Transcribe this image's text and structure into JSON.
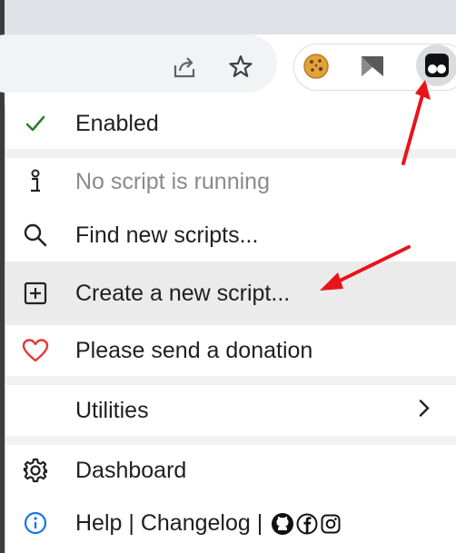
{
  "browser": {
    "toolbar_icons": {
      "share": "share-icon",
      "bookmark": "star-icon",
      "cookie_ext": "cookie-icon",
      "bookmark_ext": "bookmark-flag-icon",
      "tampermonkey": "tampermonkey-icon"
    }
  },
  "menu": {
    "enabled_label": "Enabled",
    "no_script_label": "No script is running",
    "find_label": "Find new scripts...",
    "create_label": "Create a new script...",
    "donate_label": "Please send a donation",
    "utilities_label": "Utilities",
    "dashboard_label": "Dashboard",
    "help_label": "Help",
    "divider": "|",
    "changelog_label": "Changelog"
  },
  "colors": {
    "check": "#2e7d32",
    "heart": "#e53935",
    "info": "#1a73e8",
    "annotation_arrow": "#e8141c"
  }
}
